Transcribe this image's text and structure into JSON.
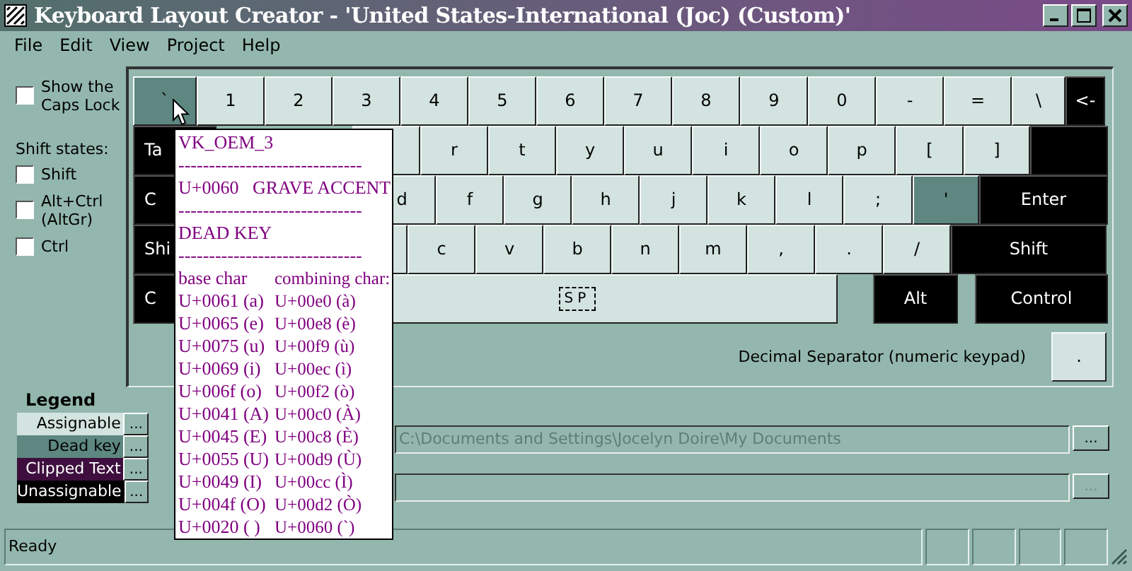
{
  "window": {
    "title": "Keyboard Layout Creator - 'United States-International (Joc) (Custom)'"
  },
  "menu": [
    "File",
    "Edit",
    "View",
    "Project",
    "Help"
  ],
  "options": {
    "caps_lock": {
      "label": "Show the Caps Lock",
      "checked": false
    },
    "shift_states_label": "Shift states:",
    "shift_states": [
      {
        "label": "Shift",
        "checked": false
      },
      {
        "label": "Alt+Ctrl (AltGr)",
        "checked": false
      },
      {
        "label": "Ctrl",
        "checked": false
      }
    ]
  },
  "keyboard": {
    "rows": {
      "number_row": [
        {
          "label": "`",
          "kind": "dead"
        },
        {
          "label": "1",
          "kind": "assignable"
        },
        {
          "label": "2",
          "kind": "assignable"
        },
        {
          "label": "3",
          "kind": "assignable"
        },
        {
          "label": "4",
          "kind": "assignable"
        },
        {
          "label": "5",
          "kind": "assignable"
        },
        {
          "label": "6",
          "kind": "assignable"
        },
        {
          "label": "7",
          "kind": "assignable"
        },
        {
          "label": "8",
          "kind": "assignable"
        },
        {
          "label": "9",
          "kind": "assignable"
        },
        {
          "label": "0",
          "kind": "assignable"
        },
        {
          "label": "-",
          "kind": "assignable"
        },
        {
          "label": "=",
          "kind": "assignable"
        },
        {
          "label": "\\",
          "kind": "assignable"
        },
        {
          "label": "<-",
          "kind": "unassignable"
        }
      ],
      "top_row": [
        {
          "label": "Ta",
          "kind": "unassignable"
        },
        {
          "kind": "assignable"
        },
        {
          "label": "r",
          "kind": "assignable"
        },
        {
          "label": "t",
          "kind": "assignable"
        },
        {
          "label": "y",
          "kind": "assignable"
        },
        {
          "label": "u",
          "kind": "assignable"
        },
        {
          "label": "i",
          "kind": "assignable"
        },
        {
          "label": "o",
          "kind": "assignable"
        },
        {
          "label": "p",
          "kind": "assignable"
        },
        {
          "label": "[",
          "kind": "assignable"
        },
        {
          "label": "]",
          "kind": "assignable"
        },
        {
          "kind": "unassignable"
        }
      ],
      "home_row": [
        {
          "label": "C",
          "kind": "unassignable"
        },
        {
          "label": "d",
          "kind": "assignable"
        },
        {
          "label": "f",
          "kind": "assignable"
        },
        {
          "label": "g",
          "kind": "assignable"
        },
        {
          "label": "h",
          "kind": "assignable"
        },
        {
          "label": "j",
          "kind": "assignable"
        },
        {
          "label": "k",
          "kind": "assignable"
        },
        {
          "label": "l",
          "kind": "assignable"
        },
        {
          "label": ";",
          "kind": "assignable"
        },
        {
          "label": "'",
          "kind": "dead"
        },
        {
          "label": "Enter",
          "kind": "unassignable"
        }
      ],
      "bottom_row": [
        {
          "label": "Shi",
          "kind": "unassignable"
        },
        {
          "kind": "assignable"
        },
        {
          "label": "c",
          "kind": "assignable"
        },
        {
          "label": "v",
          "kind": "assignable"
        },
        {
          "label": "b",
          "kind": "assignable"
        },
        {
          "label": "n",
          "kind": "assignable"
        },
        {
          "label": "m",
          "kind": "assignable"
        },
        {
          "label": ",",
          "kind": "assignable"
        },
        {
          "label": ".",
          "kind": "assignable"
        },
        {
          "label": "/",
          "kind": "assignable"
        },
        {
          "label": "Shift",
          "kind": "unassignable"
        }
      ],
      "space_row": [
        {
          "label": "C",
          "kind": "unassignable"
        },
        {
          "label": "SP",
          "kind": "assignable",
          "focused": true
        },
        {
          "label": "Alt",
          "kind": "unassignable"
        },
        {
          "label": "Control",
          "kind": "unassignable"
        }
      ]
    },
    "decimal_label": "Decimal Separator (numeric keypad)",
    "decimal_key": "."
  },
  "tooltip": {
    "lines": [
      {
        "kind": "text",
        "text": "VK_OEM_3"
      },
      {
        "kind": "text",
        "text": "------------------------------"
      },
      {
        "kind": "text",
        "text": "U+0060   GRAVE ACCENT"
      },
      {
        "kind": "text",
        "text": "------------------------------"
      },
      {
        "kind": "text",
        "text": "DEAD KEY"
      },
      {
        "kind": "text",
        "text": "------------------------------"
      },
      {
        "kind": "pair",
        "base": "base char",
        "combining": "combining char:"
      },
      {
        "kind": "pair",
        "base": "U+0061 (a)",
        "combining": "U+00e0 (à)"
      },
      {
        "kind": "pair",
        "base": "U+0065 (e)",
        "combining": "U+00e8 (è)"
      },
      {
        "kind": "pair",
        "base": "U+0075 (u)",
        "combining": "U+00f9 (ù)"
      },
      {
        "kind": "pair",
        "base": "U+0069 (i)",
        "combining": "U+00ec (ì)"
      },
      {
        "kind": "pair",
        "base": "U+006f (o)",
        "combining": "U+00f2 (ò)"
      },
      {
        "kind": "pair",
        "base": "U+0041 (A)",
        "combining": "U+00c0 (À)"
      },
      {
        "kind": "pair",
        "base": "U+0045 (E)",
        "combining": "U+00c8 (È)"
      },
      {
        "kind": "pair",
        "base": "U+0055 (U)",
        "combining": "U+00d9 (Ù)"
      },
      {
        "kind": "pair",
        "base": "U+0049 (I)",
        "combining": "U+00cc (Ì)"
      },
      {
        "kind": "pair",
        "base": "U+004f (O)",
        "combining": "U+00d2 (Ò)"
      },
      {
        "kind": "pair",
        "base": "U+0020 ( )",
        "combining": "U+0060 (`)"
      }
    ]
  },
  "legend": {
    "title": "Legend",
    "items": [
      {
        "label": "Assignable",
        "kind": "assignable",
        "button": "..."
      },
      {
        "label": "Dead key",
        "kind": "dead",
        "button": "..."
      },
      {
        "label": "Clipped Text",
        "kind": "clipped",
        "button": "..."
      },
      {
        "label": "Unassignable",
        "kind": "unassignable",
        "button": "..."
      }
    ]
  },
  "fields": [
    {
      "value": "C:\\Documents and Settings\\Jocelyn Doire\\My Documents",
      "disabled": true,
      "button": "...",
      "button_disabled": false
    },
    {
      "disabled": true,
      "button": "...",
      "button_disabled": true
    }
  ],
  "status_bar": {
    "text": "Ready"
  }
}
